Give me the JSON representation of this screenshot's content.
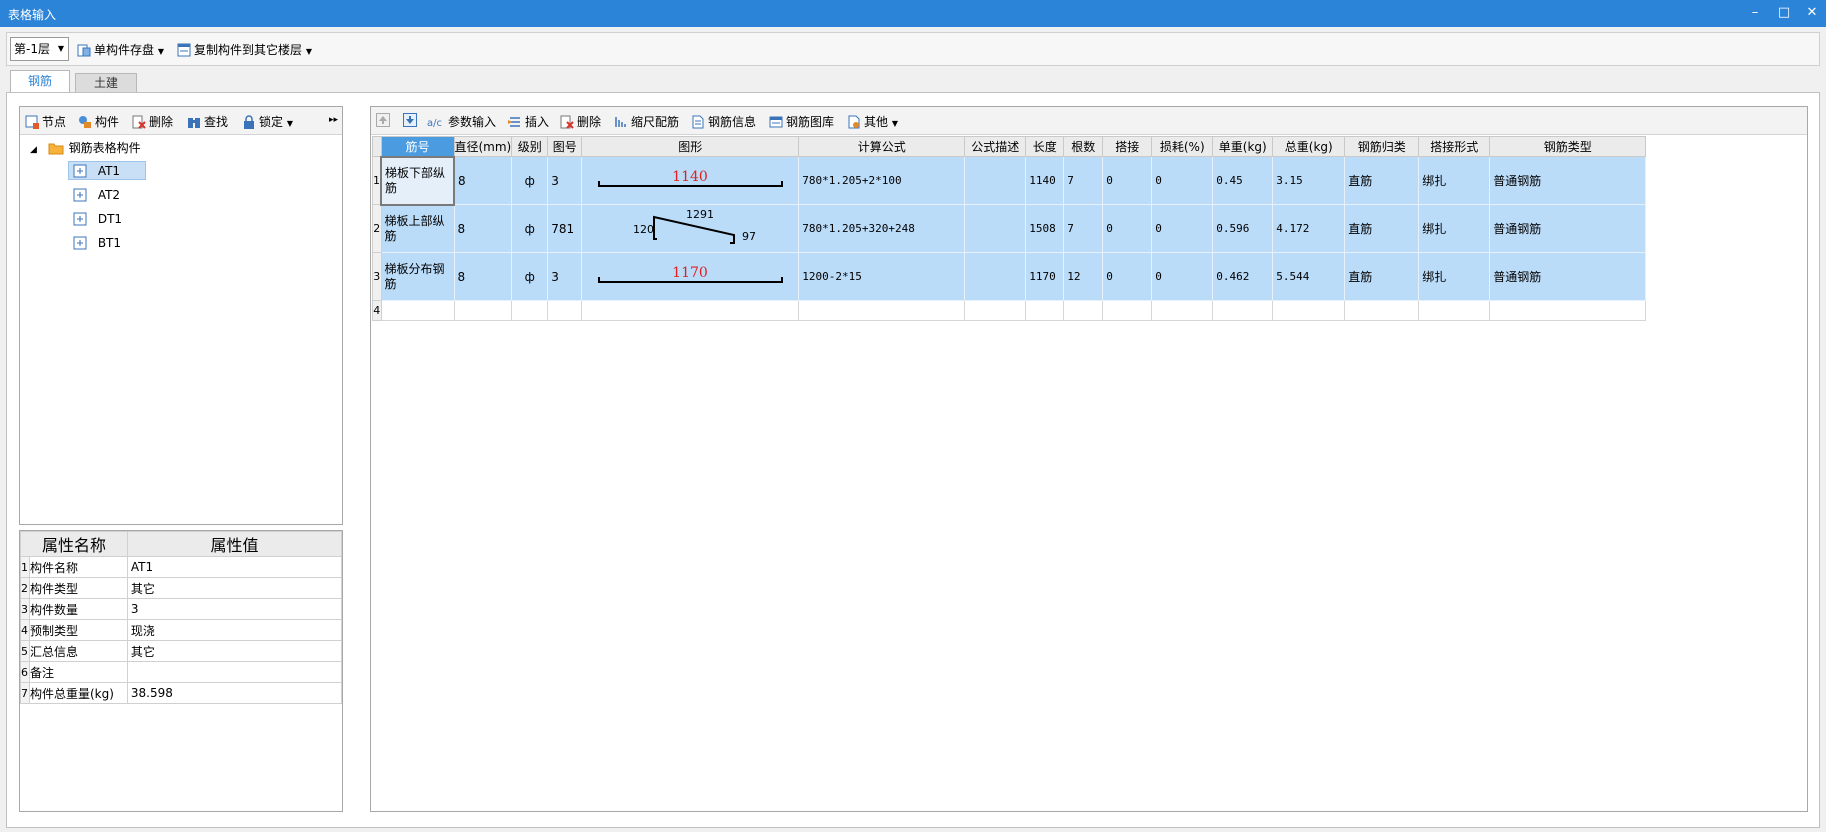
{
  "window": {
    "title": "表格输入",
    "minimize": "–",
    "maximize": "□",
    "close": "✕"
  },
  "topbar": {
    "floor_select": "第-1层",
    "save_component": "单构件存盘",
    "copy_component": "复制构件到其它楼层"
  },
  "tabs": [
    {
      "label": "钢筋",
      "active": true
    },
    {
      "label": "土建",
      "active": false
    }
  ],
  "tree_toolbar": {
    "node": "节点",
    "component": "构件",
    "delete": "删除",
    "find": "查找",
    "lock": "锁定",
    "more": "▸▸"
  },
  "tree": {
    "root": "钢筋表格构件",
    "items": [
      "AT1",
      "AT2",
      "DT1",
      "BT1"
    ],
    "selected": "AT1"
  },
  "properties": {
    "headers": [
      "属性名称",
      "属性值"
    ],
    "rows": [
      {
        "num": "1",
        "name": "构件名称",
        "value": "AT1"
      },
      {
        "num": "2",
        "name": "构件类型",
        "value": "其它"
      },
      {
        "num": "3",
        "name": "构件数量",
        "value": "3"
      },
      {
        "num": "4",
        "name": "预制类型",
        "value": "现浇"
      },
      {
        "num": "5",
        "name": "汇总信息",
        "value": "其它"
      },
      {
        "num": "6",
        "name": "备注",
        "value": ""
      },
      {
        "num": "7",
        "name": "构件总重量(kg)",
        "value": "38.598"
      }
    ]
  },
  "grid_toolbar": {
    "param_input": "参数输入",
    "insert": "插入",
    "delete": "删除",
    "scale_rebar": "缩尺配筋",
    "rebar_info": "钢筋信息",
    "rebar_library": "钢筋图库",
    "other": "其他"
  },
  "grid": {
    "headers": [
      "筋号",
      "直径(mm)",
      "级别",
      "图号",
      "图形",
      "计算公式",
      "公式描述",
      "长度",
      "根数",
      "搭接",
      "损耗(%)",
      "单重(kg)",
      "总重(kg)",
      "钢筋归类",
      "搭接形式",
      "钢筋类型"
    ],
    "rows": [
      {
        "num": "1",
        "name": "梯板下部纵筋",
        "diameter": "8",
        "grade": "ф",
        "shape_no": "3",
        "shape_label": "1140",
        "formula": "780*1.205+2*100",
        "desc": "",
        "length": "1140",
        "count": "7",
        "lap": "0",
        "loss": "0",
        "unit_weight": "0.45",
        "total_weight": "3.15",
        "category": "直筋",
        "lap_type": "绑扎",
        "rebar_type": "普通钢筋"
      },
      {
        "num": "2",
        "name": "梯板上部纵筋",
        "diameter": "8",
        "grade": "ф",
        "shape_no": "781",
        "shape_left": "120",
        "shape_mid": "1291",
        "shape_right": "97",
        "formula": "780*1.205+320+248",
        "desc": "",
        "length": "1508",
        "count": "7",
        "lap": "0",
        "loss": "0",
        "unit_weight": "0.596",
        "total_weight": "4.172",
        "category": "直筋",
        "lap_type": "绑扎",
        "rebar_type": "普通钢筋"
      },
      {
        "num": "3",
        "name": "梯板分布钢筋",
        "diameter": "8",
        "grade": "ф",
        "shape_no": "3",
        "shape_label": "1170",
        "formula": "1200-2*15",
        "desc": "",
        "length": "1170",
        "count": "12",
        "lap": "0",
        "loss": "0",
        "unit_weight": "0.462",
        "total_weight": "5.544",
        "category": "直筋",
        "lap_type": "绑扎",
        "rebar_type": "普通钢筋"
      }
    ],
    "empty_row_num": "4"
  },
  "colors": {
    "titlebar": "#2b84d8",
    "selected_row": "#bbdcf9",
    "shape_label": "#e02020"
  }
}
